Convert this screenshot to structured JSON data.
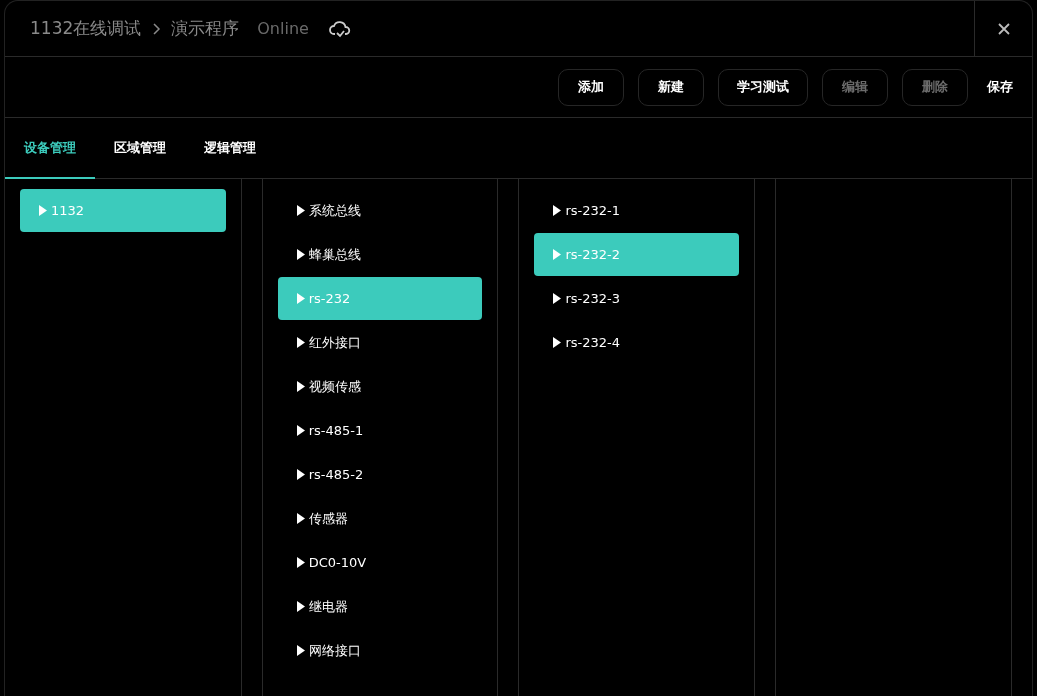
{
  "header": {
    "breadcrumb": [
      {
        "label": "1132在线调试"
      },
      {
        "label": "演示程序"
      }
    ],
    "status": "Online"
  },
  "toolbar": {
    "buttons": [
      {
        "label": "添加",
        "disabled": false,
        "kind": "outlined"
      },
      {
        "label": "新建",
        "disabled": false,
        "kind": "outlined"
      },
      {
        "label": "学习测试",
        "disabled": false,
        "kind": "outlined"
      },
      {
        "label": "编辑",
        "disabled": true,
        "kind": "outlined"
      },
      {
        "label": "删除",
        "disabled": true,
        "kind": "outlined"
      },
      {
        "label": "保存",
        "disabled": false,
        "kind": "plain"
      }
    ]
  },
  "tabs": [
    {
      "label": "设备管理",
      "selected": true
    },
    {
      "label": "区域管理",
      "selected": false
    },
    {
      "label": "逻辑管理",
      "selected": false
    }
  ],
  "columns": [
    {
      "items": [
        {
          "label": "1132",
          "selected": true
        }
      ]
    },
    {
      "items": [
        {
          "label": "系统总线",
          "selected": false
        },
        {
          "label": "蜂巢总线",
          "selected": false
        },
        {
          "label": "rs-232",
          "selected": true
        },
        {
          "label": "红外接口",
          "selected": false
        },
        {
          "label": "视频传感",
          "selected": false
        },
        {
          "label": "rs-485-1",
          "selected": false
        },
        {
          "label": "rs-485-2",
          "selected": false
        },
        {
          "label": "传感器",
          "selected": false
        },
        {
          "label": "DC0-10V",
          "selected": false
        },
        {
          "label": "继电器",
          "selected": false
        },
        {
          "label": "网络接口",
          "selected": false
        }
      ]
    },
    {
      "items": [
        {
          "label": "rs-232-1",
          "selected": false
        },
        {
          "label": "rs-232-2",
          "selected": true
        },
        {
          "label": "rs-232-3",
          "selected": false
        },
        {
          "label": "rs-232-4",
          "selected": false
        }
      ]
    }
  ]
}
